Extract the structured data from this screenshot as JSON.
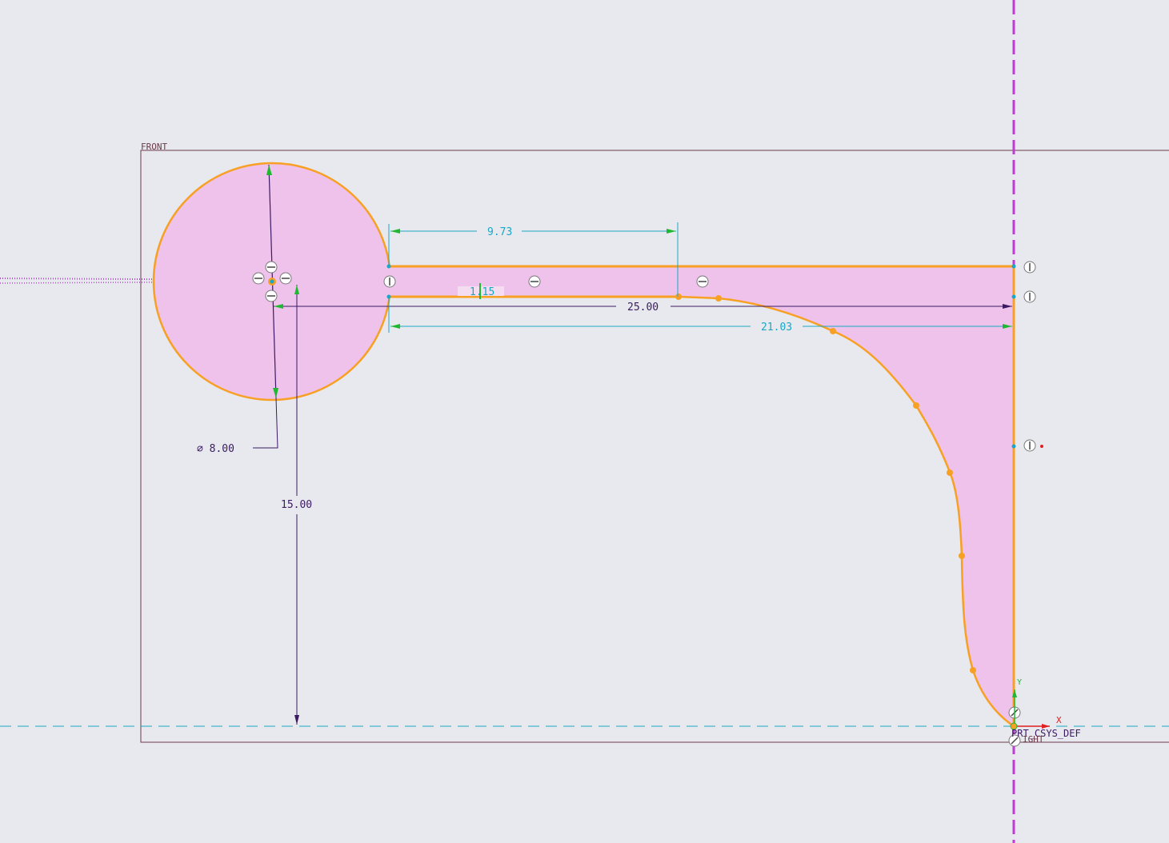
{
  "datum_planes": {
    "front_label": "FRONT",
    "right_label": "IGHT"
  },
  "csys": {
    "label": "PRT_CSYS_DEF",
    "axis_x": "X",
    "axis_y": "Y"
  },
  "dimensions": {
    "width_top": "9.73",
    "thickness": "1.15",
    "length_total": "25.00",
    "length_lower": "21.03",
    "diameter": "∅ 8.00",
    "height": "15.00"
  },
  "colors": {
    "background": "#e8e9ee",
    "sketch_fill": "#eec2ea",
    "sketch_edge": "#f7a024",
    "dimension_strong": "#3b1a63",
    "dimension_weak": "#1aa6c4",
    "datum_plane": "#6b3b4a",
    "centerline": "#c23ad6"
  },
  "icons": {
    "constraint_vertical": "vertical-constraint-icon",
    "constraint_horizontal": "horizontal-constraint-icon",
    "constraint_tangent": "tangent-constraint-icon"
  }
}
